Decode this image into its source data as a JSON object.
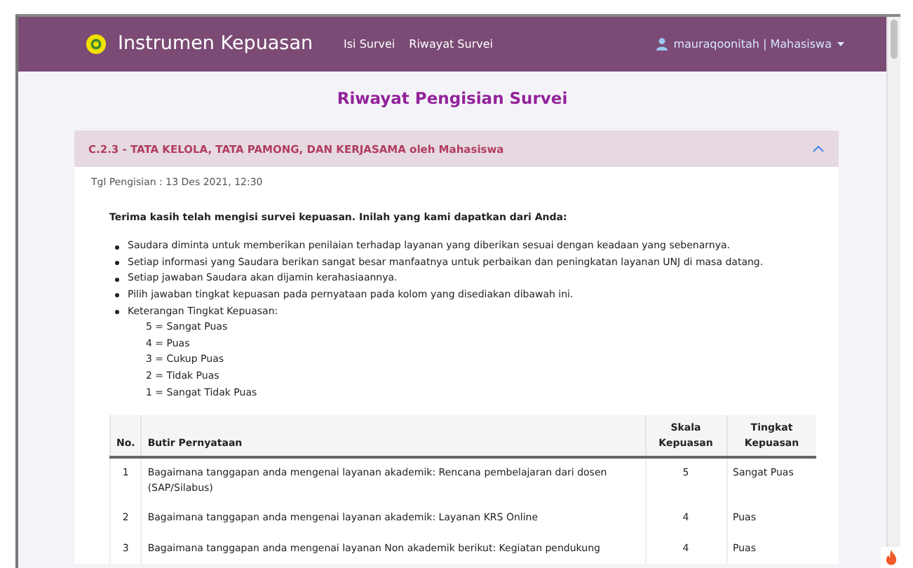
{
  "navbar": {
    "brand": "Instrumen Kepuasan",
    "links": [
      {
        "label": "Isi Survei",
        "selected": false
      },
      {
        "label": "Riwayat Survei",
        "selected": false
      }
    ],
    "user": "mauraqoonitah | Mahasiswa"
  },
  "page_title": "Riwayat Pengisian Survei",
  "accordion": {
    "title": "C.2.3 - TATA KELOLA, TATA PAMONG, DAN KERJASAMA oleh Mahasiswa",
    "expanded": true
  },
  "date": "Tgl Pengisian : 13 Des 2021, 12:30",
  "intro": "Terima kasih telah mengisi survei kepuasan. Inilah yang kami dapatkan dari Anda:",
  "bullets": [
    "Saudara diminta untuk memberikan penilaian terhadap layanan yang diberikan sesuai dengan keadaan yang sebenarnya.",
    "Setiap informasi yang Saudara berikan sangat besar manfaatnya untuk perbaikan dan peningkatan layanan UNJ di masa datang.",
    "Setiap jawaban Saudara akan dijamin kerahasiaannya.",
    "Pilih jawaban tingkat kepuasan pada pernyataan pada kolom yang disediakan dibawah ini.",
    "Keterangan Tingkat Kepuasan:"
  ],
  "legend": [
    "5 = Sangat Puas",
    "4 = Puas",
    "3 = Cukup Puas",
    "2 = Tidak Puas",
    "1 = Sangat Tidak Puas"
  ],
  "table": {
    "columns": [
      "No.",
      "Butir Pernyataan",
      "Skala Kepuasan",
      "Tingkat Kepuasan"
    ],
    "rows": [
      [
        "1",
        "Bagaimana tanggapan anda mengenai layanan akademik: Rencana pembelajaran dari dosen (SAP/Silabus)",
        "5",
        "Sangat Puas"
      ],
      [
        "2",
        "Bagaimana tanggapan anda mengenai layanan akademik: Layanan KRS Online",
        "4",
        "Puas"
      ],
      [
        "3",
        "Bagaimana tanggapan anda mengenai layanan Non akademik berikut: Kegiatan pendukung",
        "4",
        "Puas"
      ]
    ]
  }
}
